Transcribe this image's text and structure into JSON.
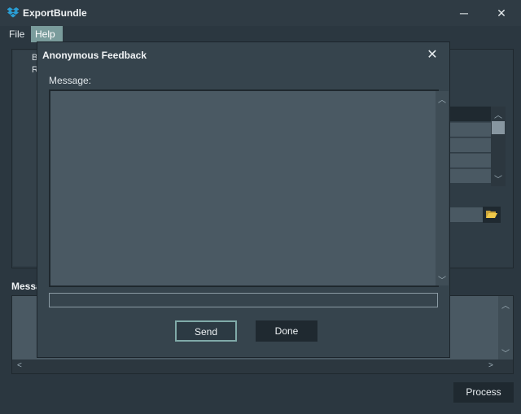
{
  "window": {
    "title": "ExportBundle",
    "minimize_glyph": "─",
    "close_glyph": "✕"
  },
  "menu": {
    "file": "File",
    "help": "Help"
  },
  "background": {
    "fragment_1": "B",
    "fragment_2": "R",
    "messages_label": "Messa",
    "process_button": "Process"
  },
  "dialog": {
    "title": "Anonymous Feedback",
    "close_glyph": "✕",
    "message_label": "Message:",
    "message_value": "",
    "subject_value": "",
    "send_button": "Send",
    "done_button": "Done"
  },
  "colors": {
    "accent": "#7a9c9c",
    "window_bg": "#2b3740",
    "dialog_bg": "#36444d",
    "field_bg": "#4a5963"
  },
  "icons": {
    "app": "dropbox-like-icon",
    "folder": "folder-open-icon"
  }
}
